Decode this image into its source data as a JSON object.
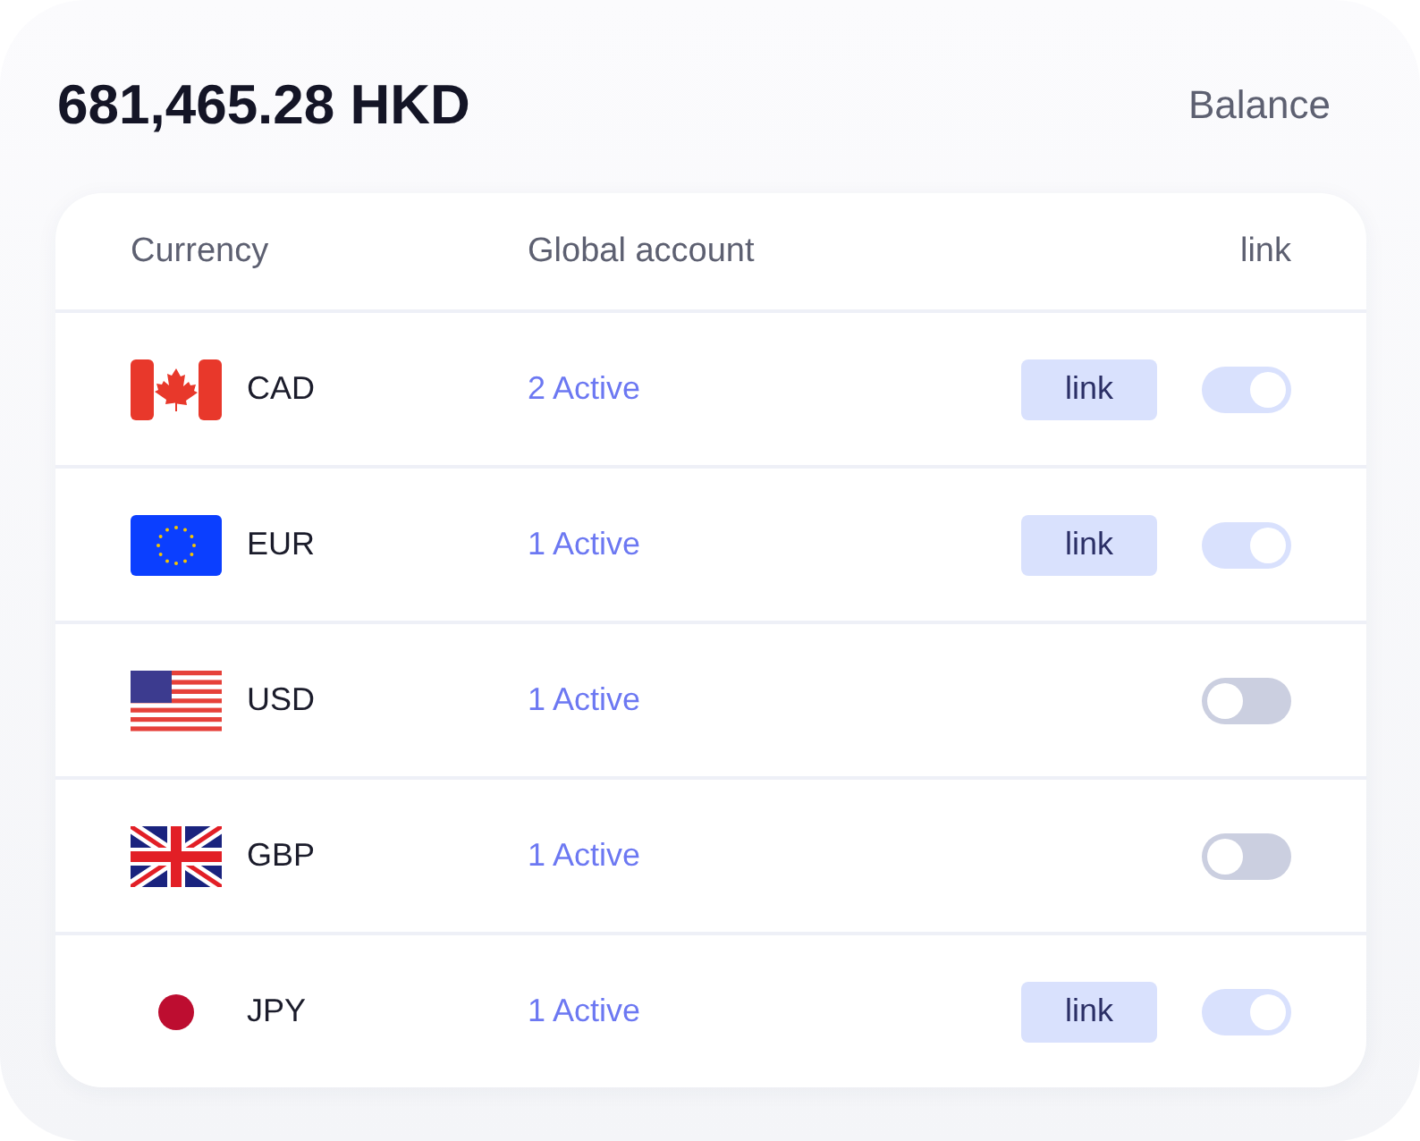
{
  "balance": {
    "amount": "681,465.28 HKD",
    "label": "Balance"
  },
  "table": {
    "columns": [
      "Currency",
      "Global account",
      "link"
    ],
    "rows": [
      {
        "kind": "ca",
        "code": "CAD",
        "accounts": "2 Active",
        "link_button": "link",
        "on": true
      },
      {
        "kind": "eu",
        "code": "EUR",
        "accounts": "1 Active",
        "link_button": "link",
        "on": true
      },
      {
        "kind": "us",
        "code": "USD",
        "accounts": "1 Active",
        "on": false
      },
      {
        "kind": "gb",
        "code": "GBP",
        "accounts": "1 Active",
        "on": false
      },
      {
        "kind": "jp",
        "code": "JPY",
        "accounts": "1 Active",
        "link_button": "link",
        "on": true
      }
    ]
  }
}
